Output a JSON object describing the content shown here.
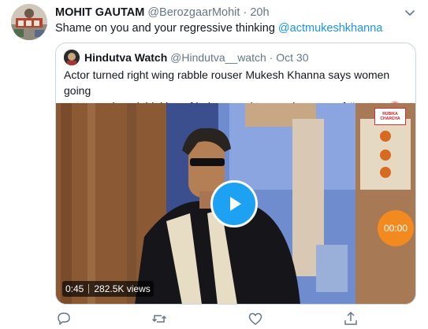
{
  "tweet": {
    "author_name": "MOHIT GAUTAM",
    "author_handle": "@BerozgaarMohit",
    "separator": "·",
    "time": "20h",
    "text_prefix": "Shame on you and your regressive thinking ",
    "mention": "@actmukeshkhanna",
    "avatar_icon": "profile-photo-icon",
    "menu_icon": "chevron-down-icon"
  },
  "quote": {
    "author_name": "Hindutva Watch",
    "author_handle": "@Hindutva__watch",
    "separator": "·",
    "time": "Oct 30",
    "text_line1": "Actor turned right wing rabble rouser Mukesh Khanna says women going",
    "text_line2": "out to work and thinking of being equal to men is cause of #metoo ",
    "emoji_icon": "emoji-icon"
  },
  "video": {
    "duration": "0:45",
    "views": "282.5K views",
    "timer_badge": "00:00",
    "logo_line1": "RUBIKA",
    "logo_line2": "CHARCHA",
    "play_icon": "play-icon"
  },
  "actions": {
    "reply_icon": "reply-icon",
    "retweet_icon": "retweet-icon",
    "like_icon": "heart-icon",
    "share_icon": "share-icon"
  },
  "colors": {
    "accent": "#1da1f2",
    "link": "#1b95e0",
    "secondary_text": "#657786",
    "timer_badge": "#f38a1f"
  }
}
